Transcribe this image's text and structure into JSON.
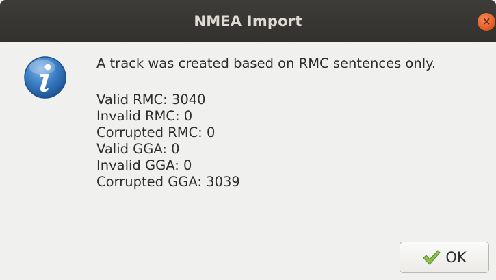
{
  "window": {
    "title": "NMEA Import",
    "close_glyph": "×"
  },
  "message": {
    "headline": "A track was created based on RMC sentences only.",
    "stats": [
      "Valid RMC: 3040",
      "Invalid RMC: 0",
      "Corrupted RMC: 0",
      "Valid GGA: 0",
      "Invalid GGA: 0",
      "Corrupted GGA: 3039"
    ]
  },
  "buttons": {
    "ok_label": "OK"
  },
  "icons": {
    "info": "info-icon",
    "check": "check-icon",
    "close": "close-icon"
  },
  "colors": {
    "titlebar": "#35342f",
    "close_button": "#e9622b",
    "info_icon": "#2a6fb5",
    "check_icon": "#7cb342"
  }
}
